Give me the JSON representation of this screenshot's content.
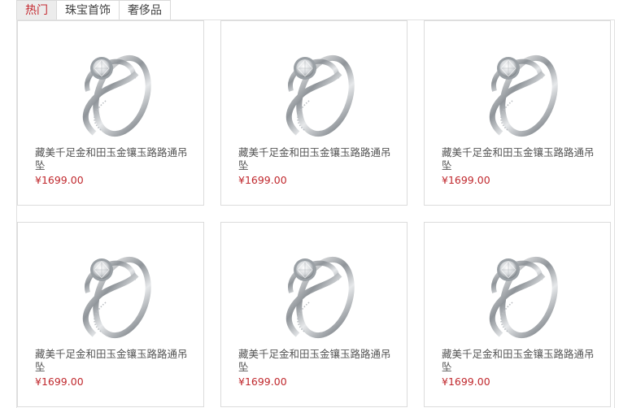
{
  "tabs": [
    {
      "label": "热门"
    },
    {
      "label": "珠宝首饰"
    },
    {
      "label": "奢侈品"
    }
  ],
  "products": [
    {
      "title": "藏美千足金和田玉金镶玉路路通吊坠",
      "price": "¥1699.00"
    },
    {
      "title": "藏美千足金和田玉金镶玉路路通吊坠",
      "price": "¥1699.00"
    },
    {
      "title": "藏美千足金和田玉金镶玉路路通吊坠",
      "price": "¥1699.00"
    },
    {
      "title": "藏美千足金和田玉金镶玉路路通吊坠",
      "price": "¥1699.00"
    },
    {
      "title": "藏美千足金和田玉金镶玉路路通吊坠",
      "price": "¥1699.00"
    },
    {
      "title": "藏美千足金和田玉金镶玉路路通吊坠",
      "price": "¥1699.00"
    }
  ],
  "colors": {
    "active_tab": "#c4282f",
    "price": "#c0282d"
  },
  "icons": {
    "product_image": "diamond-ring-icon"
  }
}
